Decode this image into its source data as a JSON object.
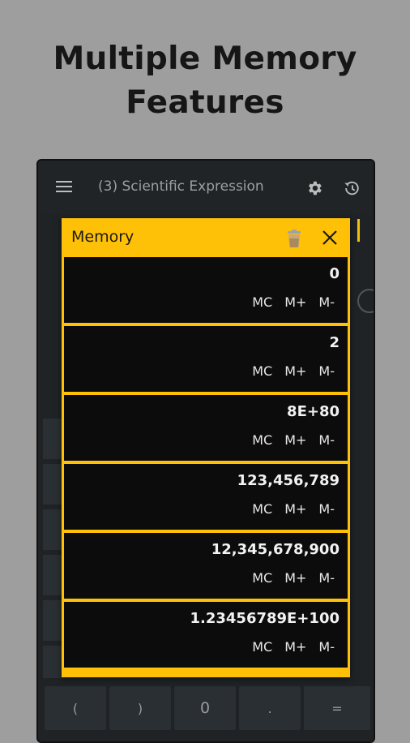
{
  "headline": {
    "line1": "Multiple Memory",
    "line2": "Features"
  },
  "app": {
    "title": "(3) Scientific Expression",
    "icons": [
      "menu-icon",
      "gear-icon",
      "history-icon"
    ]
  },
  "keypad_bottom": [
    "(",
    ")",
    "0",
    ".",
    "="
  ],
  "memory_dialog": {
    "title": "Memory",
    "accent_color": "#ffc107",
    "items": [
      {
        "value": "0",
        "mc": "MC",
        "mplus": "M+",
        "mminus": "M-"
      },
      {
        "value": "2",
        "mc": "MC",
        "mplus": "M+",
        "mminus": "M-"
      },
      {
        "value": "8E+80",
        "mc": "MC",
        "mplus": "M+",
        "mminus": "M-"
      },
      {
        "value": "123,456,789",
        "mc": "MC",
        "mplus": "M+",
        "mminus": "M-"
      },
      {
        "value": "12,345,678,900",
        "mc": "MC",
        "mplus": "M+",
        "mminus": "M-"
      },
      {
        "value": "1.23456789E+100",
        "mc": "MC",
        "mplus": "M+",
        "mminus": "M-"
      }
    ]
  }
}
